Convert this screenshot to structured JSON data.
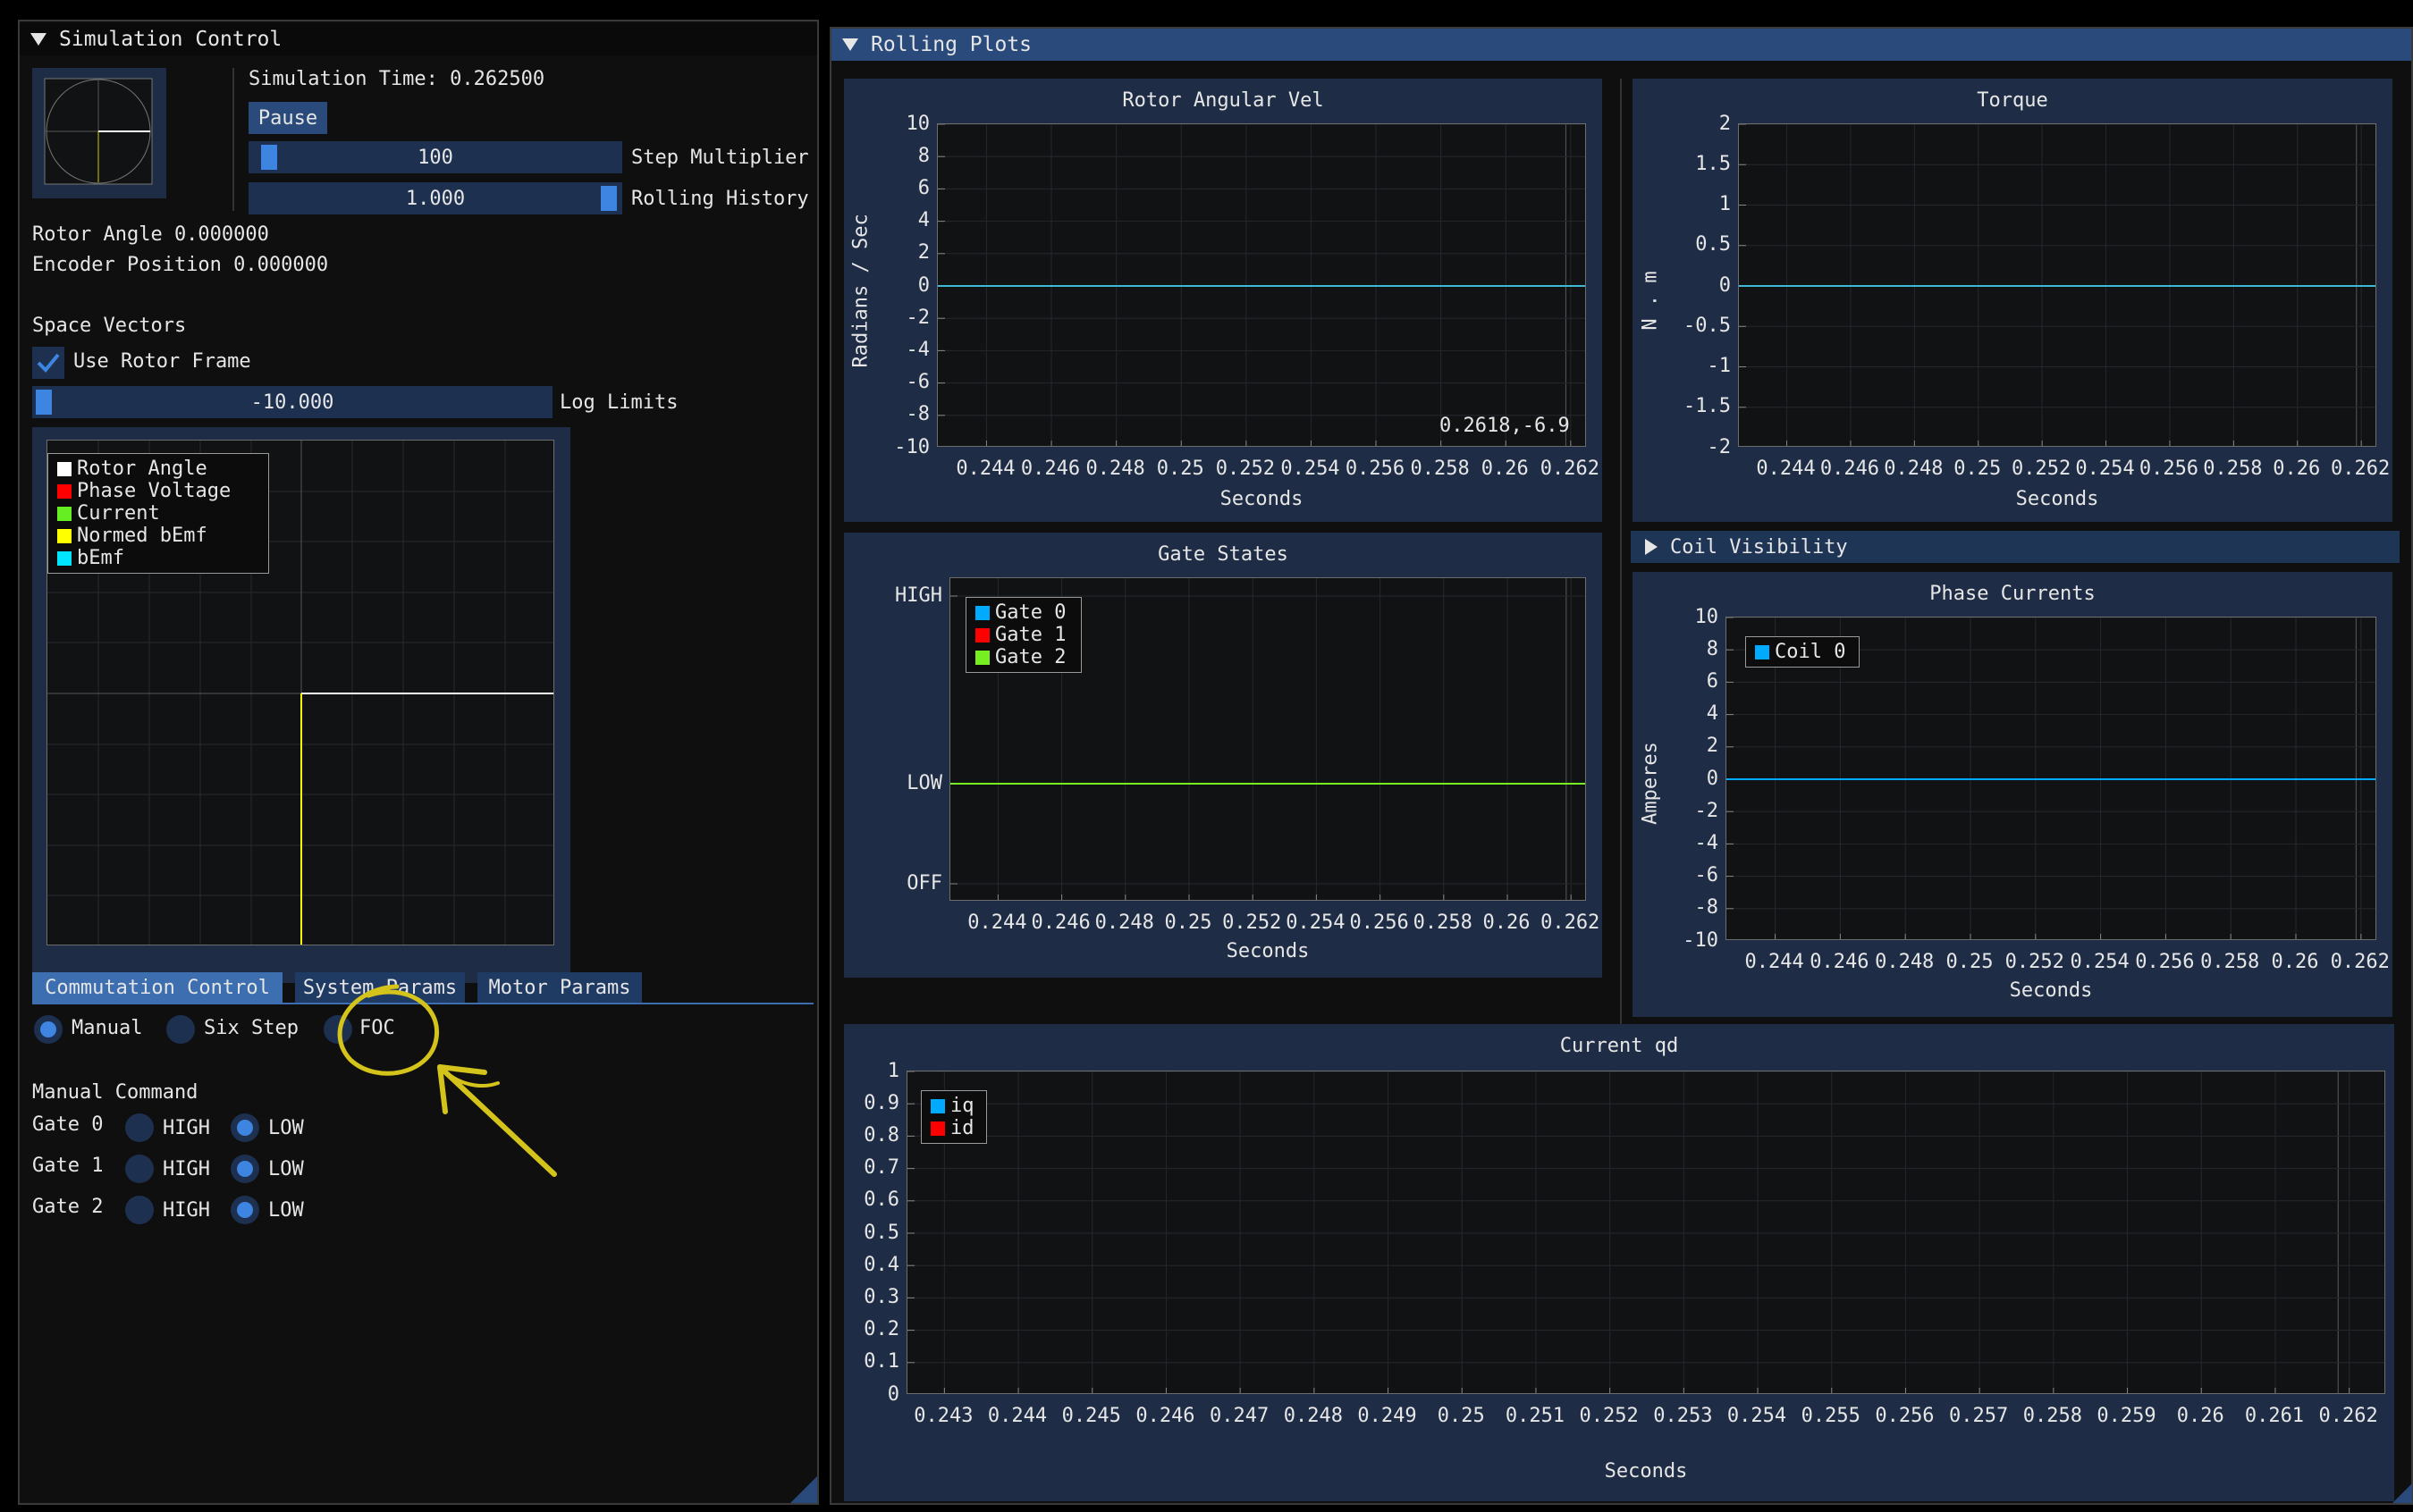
{
  "sim_control": {
    "title": "Simulation Control",
    "sim_time_label": "Simulation Time: 0.262500",
    "pause_label": "Pause",
    "step_multiplier": {
      "value": "100",
      "label": "Step Multiplier"
    },
    "rolling_history": {
      "value": "1.000",
      "label": "Rolling History"
    },
    "rotor_angle": "Rotor Angle 0.000000",
    "encoder_position": "Encoder Position 0.000000",
    "space_vectors_title": "Space Vectors",
    "use_rotor_frame": {
      "label": "Use Rotor Frame",
      "checked": true
    },
    "log_limits": {
      "value": "-10.000",
      "label": "Log Limits"
    },
    "space_vector_legend": [
      {
        "name": "Rotor Angle",
        "color": "#ffffff"
      },
      {
        "name": "Phase Voltage",
        "color": "#ff0000"
      },
      {
        "name": "Current",
        "color": "#66ee22"
      },
      {
        "name": "Normed bEmf",
        "color": "#ffff00"
      },
      {
        "name": "bEmf",
        "color": "#00e5ff"
      }
    ],
    "tabs": [
      {
        "label": "Commutation Control",
        "active": true
      },
      {
        "label": "System Params",
        "active": false
      },
      {
        "label": "Motor Params",
        "active": false
      }
    ],
    "modes": [
      {
        "label": "Manual",
        "selected": true
      },
      {
        "label": "Six Step",
        "selected": false
      },
      {
        "label": "FOC",
        "selected": false
      }
    ],
    "manual_command_title": "Manual Command",
    "gates": [
      {
        "label": "Gate 0",
        "high": "HIGH",
        "low": "LOW",
        "state": "LOW"
      },
      {
        "label": "Gate 1",
        "high": "HIGH",
        "low": "LOW",
        "state": "LOW"
      },
      {
        "label": "Gate 2",
        "high": "HIGH",
        "low": "LOW",
        "state": "LOW"
      }
    ]
  },
  "rolling_plots": {
    "title": "Rolling Plots",
    "coil_visibility_label": "Coil Visibility",
    "x_ticks_common": [
      "0.244",
      "0.246",
      "0.248",
      "0.25",
      "0.252",
      "0.254",
      "0.256",
      "0.258",
      "0.26",
      "0.262"
    ],
    "x_ticks_current_qd": [
      "0.243",
      "0.244",
      "0.245",
      "0.246",
      "0.247",
      "0.248",
      "0.249",
      "0.25",
      "0.251",
      "0.252",
      "0.253",
      "0.254",
      "0.255",
      "0.256",
      "0.257",
      "0.258",
      "0.259",
      "0.26",
      "0.261",
      "0.262"
    ]
  },
  "chart_data": [
    {
      "type": "line",
      "title": "Rotor Angular Vel",
      "xlabel": "Seconds",
      "ylabel": "Radians / Sec",
      "xlim": [
        0.2425,
        0.2625
      ],
      "ylim": [
        -10,
        10
      ],
      "y_ticks": [
        "10",
        "8",
        "6",
        "4",
        "2",
        "0",
        "-2",
        "-4",
        "-6",
        "-8",
        "-10"
      ],
      "cursor_readout": "0.2618,-6.9",
      "series": [
        {
          "values_x": [
            0.2425,
            0.2625
          ],
          "values_y": [
            0,
            0
          ],
          "color": "#3fb8d8"
        }
      ]
    },
    {
      "type": "line",
      "title": "Torque",
      "xlabel": "Seconds",
      "ylabel": "N . m",
      "xlim": [
        0.2425,
        0.2625
      ],
      "ylim": [
        -2,
        2
      ],
      "y_ticks": [
        "2",
        "1.5",
        "1",
        "0.5",
        "0",
        "-0.5",
        "-1",
        "-1.5",
        "-2"
      ],
      "series": [
        {
          "values_x": [
            0.2425,
            0.2625
          ],
          "values_y": [
            0,
            0
          ],
          "color": "#3fb8d8"
        }
      ]
    },
    {
      "type": "line",
      "title": "Gate States",
      "xlabel": "Seconds",
      "ylabel": "",
      "xlim": [
        0.2425,
        0.2625
      ],
      "y_ticks": [
        "HIGH",
        "LOW",
        "OFF"
      ],
      "series": [
        {
          "name": "Gate 0",
          "color": "#00aaff",
          "values_x": [
            0.2425,
            0.2625
          ],
          "values_y": [
            "LOW",
            "LOW"
          ]
        },
        {
          "name": "Gate 1",
          "color": "#ff0000",
          "values_x": [
            0.2425,
            0.2625
          ],
          "values_y": [
            "LOW",
            "LOW"
          ]
        },
        {
          "name": "Gate 2",
          "color": "#77ee22",
          "values_x": [
            0.2425,
            0.2625
          ],
          "values_y": [
            "LOW",
            "LOW"
          ]
        }
      ]
    },
    {
      "type": "line",
      "title": "Phase Currents",
      "xlabel": "Seconds",
      "ylabel": "Amperes",
      "xlim": [
        0.2425,
        0.2625
      ],
      "ylim": [
        -10,
        10
      ],
      "y_ticks": [
        "10",
        "8",
        "6",
        "4",
        "2",
        "0",
        "-2",
        "-4",
        "-6",
        "-8",
        "-10"
      ],
      "series": [
        {
          "name": "Coil 0",
          "color": "#00aaff",
          "values_x": [
            0.2425,
            0.2625
          ],
          "values_y": [
            0,
            0
          ]
        }
      ]
    },
    {
      "type": "line",
      "title": "Current qd",
      "xlabel": "Seconds",
      "ylabel": "",
      "xlim": [
        0.2425,
        0.2625
      ],
      "ylim": [
        0,
        1
      ],
      "y_ticks": [
        "1",
        "0.9",
        "0.8",
        "0.7",
        "0.6",
        "0.5",
        "0.4",
        "0.3",
        "0.2",
        "0.1",
        "0"
      ],
      "series": [
        {
          "name": "iq",
          "color": "#00aaff"
        },
        {
          "name": "id",
          "color": "#ff0000"
        }
      ]
    }
  ],
  "colors": {
    "title_blue": "#294a7a",
    "frame_blue": "#1e2d45",
    "accent": "#3d85e0",
    "annotation": "#d4c31a"
  }
}
